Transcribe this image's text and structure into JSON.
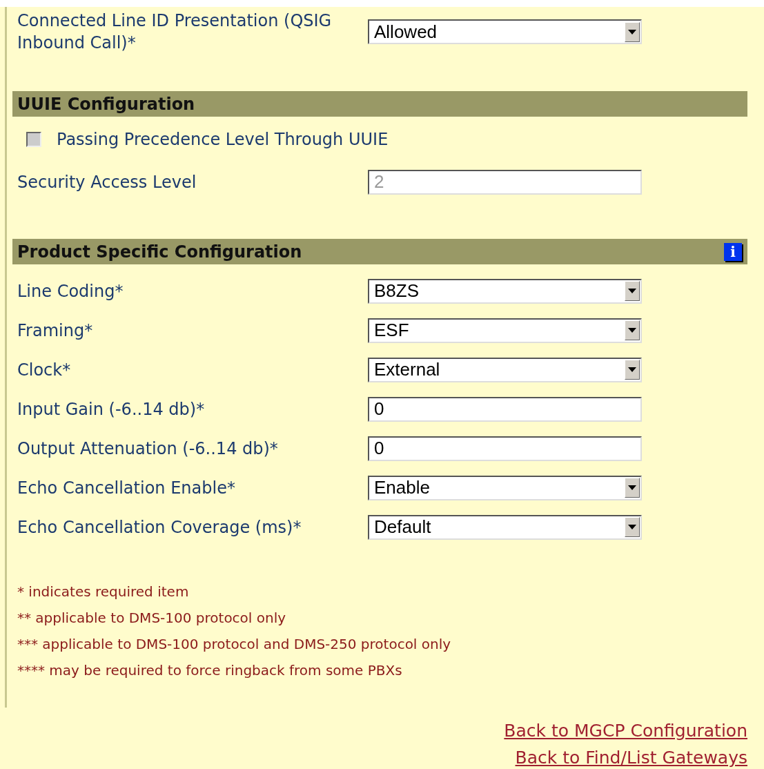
{
  "top_fields": [
    {
      "kind": "select",
      "label": "Connected Line ID Presentation (QSIG Inbound Call)*",
      "value": "Allowed",
      "disabled": false
    }
  ],
  "sections": [
    {
      "title": "UUIE Configuration",
      "fields": [
        {
          "kind": "checkbox",
          "label": "Passing Precedence Level Through UUIE",
          "checked": false,
          "disabled": true
        },
        {
          "kind": "input",
          "label": "Security Access Level",
          "value": "2",
          "disabled": true
        }
      ]
    },
    {
      "title": "Product Specific Configuration",
      "info_icon": "i",
      "fields": [
        {
          "kind": "select",
          "label": "Line Coding*",
          "value": "B8ZS",
          "disabled": false
        },
        {
          "kind": "select",
          "label": "Framing*",
          "value": "ESF",
          "disabled": false
        },
        {
          "kind": "select",
          "label": "Clock*",
          "value": "External",
          "disabled": false
        },
        {
          "kind": "input",
          "label": "Input Gain (-6..14 db)*",
          "value": "0",
          "disabled": false
        },
        {
          "kind": "input",
          "label": "Output Attenuation (-6..14 db)*",
          "value": "0",
          "disabled": false
        },
        {
          "kind": "select",
          "label": "Echo Cancellation Enable*",
          "value": "Enable",
          "disabled": false
        },
        {
          "kind": "select",
          "label": "Echo Cancellation Coverage (ms)*",
          "value": "Default",
          "disabled": false
        }
      ]
    }
  ],
  "footnotes": [
    "* indicates required item",
    "** applicable to DMS-100 protocol only",
    "*** applicable to DMS-100 protocol and DMS-250 protocol only",
    "**** may be required to force ringback from some PBXs"
  ],
  "links": [
    "Back to MGCP Configuration",
    "Back to Find/List Gateways"
  ]
}
